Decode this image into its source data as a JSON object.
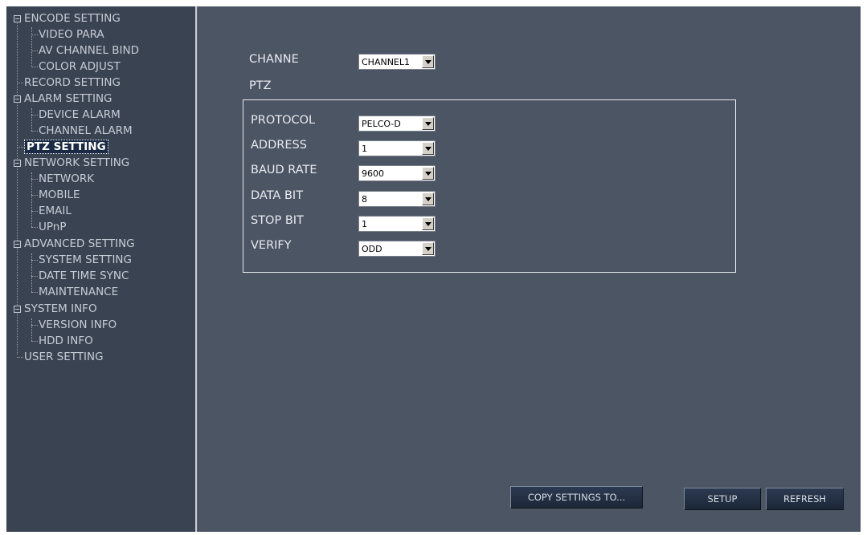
{
  "sidebar": {
    "items": [
      {
        "label": "ENCODE SETTING"
      },
      {
        "label": "VIDEO PARA"
      },
      {
        "label": "AV CHANNEL BIND"
      },
      {
        "label": "COLOR ADJUST"
      },
      {
        "label": "RECORD SETTING"
      },
      {
        "label": "ALARM SETTING"
      },
      {
        "label": "DEVICE ALARM"
      },
      {
        "label": "CHANNEL ALARM"
      },
      {
        "label": "PTZ SETTING"
      },
      {
        "label": "NETWORK SETTING"
      },
      {
        "label": "NETWORK"
      },
      {
        "label": "MOBILE"
      },
      {
        "label": "EMAIL"
      },
      {
        "label": "UPnP"
      },
      {
        "label": "ADVANCED SETTING"
      },
      {
        "label": "SYSTEM SETTING"
      },
      {
        "label": "DATE TIME SYNC"
      },
      {
        "label": "MAINTENANCE"
      },
      {
        "label": "SYSTEM INFO"
      },
      {
        "label": "VERSION INFO"
      },
      {
        "label": "HDD INFO"
      },
      {
        "label": "USER SETTING"
      }
    ],
    "selected": "PTZ SETTING"
  },
  "channel": {
    "label": "CHANNE",
    "value": "CHANNEL1"
  },
  "ptz_title": "PTZ",
  "ptz_fields": {
    "protocol": {
      "label": "PROTOCOL",
      "value": "PELCO-D"
    },
    "address": {
      "label": "ADDRESS",
      "value": "1"
    },
    "baud_rate": {
      "label": "BAUD RATE",
      "value": "9600"
    },
    "data_bit": {
      "label": "DATA BIT",
      "value": "8"
    },
    "stop_bit": {
      "label": "STOP BIT",
      "value": "1"
    },
    "verify": {
      "label": "VERIFY",
      "value": "ODD"
    }
  },
  "buttons": {
    "copy": "COPY SETTINGS TO...",
    "setup": "SETUP",
    "refresh": "REFRESH"
  },
  "colors": {
    "background": "#4c5564",
    "sidebar": "#3a4352",
    "text": "#e8ebef"
  }
}
